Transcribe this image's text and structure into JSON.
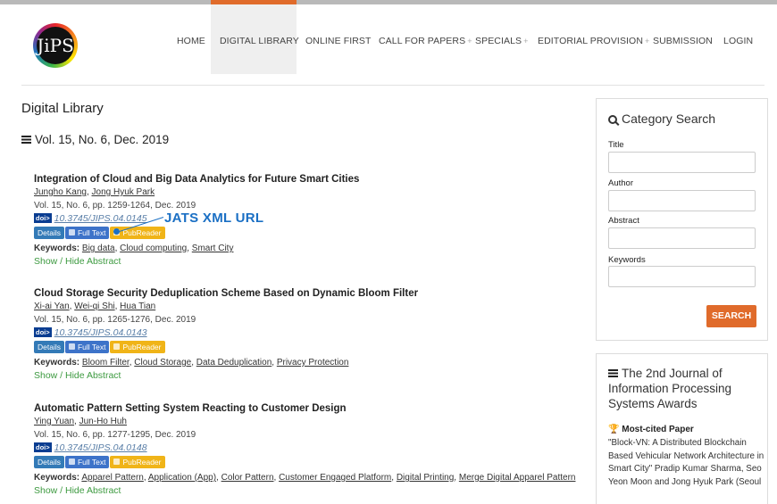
{
  "logo": {
    "text": "JiPS"
  },
  "nav": {
    "items": [
      {
        "label": "HOME",
        "plus": ""
      },
      {
        "label": "DIGITAL LIBRARY",
        "plus": ""
      },
      {
        "label": "ONLINE FIRST",
        "plus": ""
      },
      {
        "label": "CALL FOR PAPERS",
        "plus": "+"
      },
      {
        "label": "SPECIALS",
        "plus": "+"
      },
      {
        "label": "EDITORIAL PROVISION",
        "plus": "+"
      },
      {
        "label": "SUBMISSION",
        "plus": ""
      },
      {
        "label": "LOGIN",
        "plus": ""
      }
    ],
    "active": "DIGITAL LIBRARY"
  },
  "page": {
    "title": "Digital Library",
    "volume": "Vol. 15, No. 6, Dec. 2019"
  },
  "buttons": {
    "details": "Details",
    "full_text": "Full Text",
    "pubreader": "PubReader",
    "toggle_abstract": "Show / Hide Abstract",
    "keywords_label": "Keywords:",
    "doi_badge": "doi>"
  },
  "annotation": {
    "label": "JATS XML URL",
    "color": "#1a6fc4"
  },
  "articles": [
    {
      "title": "Integration of Cloud and Big Data Analytics for Future Smart Cities",
      "authors": [
        "Jungho Kang",
        "Jong Hyuk Park"
      ],
      "meta": "Vol. 15, No. 6, pp. 1259-1264, Dec. 2019",
      "doi": "10.3745/JIPS.04.0145",
      "keywords": [
        "Big data",
        "Cloud computing",
        "Smart City"
      ]
    },
    {
      "title": "Cloud Storage Security Deduplication Scheme Based on Dynamic Bloom Filter",
      "authors": [
        "Xi-ai Yan",
        "Wei-qi Shi",
        "Hua Tian"
      ],
      "meta": "Vol. 15, No. 6, pp. 1265-1276, Dec. 2019",
      "doi": "10.3745/JIPS.04.0143",
      "keywords": [
        "Bloom Filter",
        "Cloud Storage",
        "Data Deduplication",
        "Privacy Protection"
      ]
    },
    {
      "title": "Automatic Pattern Setting System Reacting to Customer Design",
      "authors": [
        "Ying Yuan",
        "Jun-Ho Huh"
      ],
      "meta": "Vol. 15, No. 6, pp. 1277-1295, Dec. 2019",
      "doi": "10.3745/JIPS.04.0148",
      "keywords": [
        "Apparel Pattern",
        "Application (App)",
        "Color Pattern",
        "Customer Engaged Platform",
        "Digital Printing",
        "Merge Digital Apparel Pattern"
      ]
    }
  ],
  "sidebar": {
    "search": {
      "heading": "Category Search",
      "fields": [
        {
          "label": "Title",
          "value": ""
        },
        {
          "label": "Author",
          "value": ""
        },
        {
          "label": "Abstract",
          "value": ""
        },
        {
          "label": "Keywords",
          "value": ""
        }
      ],
      "button": "SEARCH"
    },
    "awards": {
      "heading": "The 2nd Journal of Information Processing Systems Awards",
      "subheading": "Most-cited Paper",
      "text": "\"Block-VN: A Distributed Blockchain Based Vehicular Network Architecture in Smart City\" Pradip Kumar Sharma, Seo Yeon Moon and Jong Hyuk Park (Seoul"
    }
  },
  "colors": {
    "accent": "#e06b2b",
    "details_button": "#337ab7",
    "full_text_button": "#3d73c9",
    "pubreader_button": "#f0b418",
    "toggle_link": "#3d9a40",
    "doi_badge": "#0a3d91"
  }
}
